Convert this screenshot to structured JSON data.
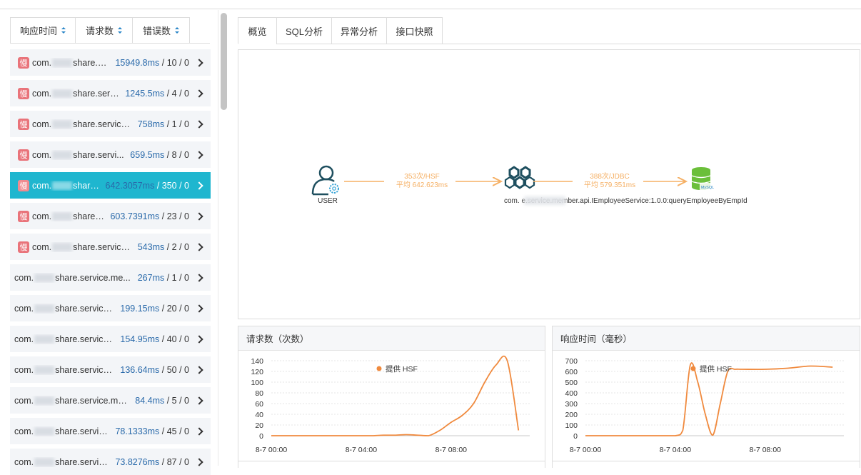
{
  "sort_tabs": [
    {
      "label": "响应时间"
    },
    {
      "label": "请求数"
    },
    {
      "label": "错误数"
    }
  ],
  "slow_label": "慢",
  "rows": [
    {
      "prefix": "com.",
      "suffix": "share.s...",
      "ms": "15949.8ms",
      "rest": " / 10 / 0",
      "slow": true
    },
    {
      "prefix": "com.",
      "suffix": "share.serv...",
      "ms": "1245.5ms",
      "rest": " / 4 / 0",
      "slow": true
    },
    {
      "prefix": "com.",
      "suffix": "share.service...",
      "ms": "758ms",
      "rest": " / 1 / 0",
      "slow": true
    },
    {
      "prefix": "com.",
      "suffix": "share.servi...",
      "ms": "659.5ms",
      "rest": " / 8 / 0",
      "slow": true
    },
    {
      "prefix": "com.",
      "suffix": "share...",
      "ms": "642.3057ms",
      "rest": " / 350 / 0",
      "slow": true,
      "active": true
    },
    {
      "prefix": "com.",
      "suffix": "share....",
      "ms": "603.7391ms",
      "rest": " / 23 / 0",
      "slow": true
    },
    {
      "prefix": "com.",
      "suffix": "share.service...",
      "ms": "543ms",
      "rest": " / 2 / 0",
      "slow": true
    },
    {
      "prefix": "com.",
      "suffix": "share.service.me...",
      "ms": "267ms",
      "rest": " / 1 / 0",
      "slow": false
    },
    {
      "prefix": "com.",
      "suffix": "share.service....",
      "ms": "199.15ms",
      "rest": " / 20 / 0",
      "slow": false
    },
    {
      "prefix": "com.",
      "suffix": "share.service....",
      "ms": "154.95ms",
      "rest": " / 40 / 0",
      "slow": false
    },
    {
      "prefix": "com.",
      "suffix": "share.service....",
      "ms": "136.64ms",
      "rest": " / 50 / 0",
      "slow": false
    },
    {
      "prefix": "com.",
      "suffix": "share.service.me...",
      "ms": "84.4ms",
      "rest": " / 5 / 0",
      "slow": false
    },
    {
      "prefix": "com.",
      "suffix": "share.servic...",
      "ms": "78.1333ms",
      "rest": " / 45 / 0",
      "slow": false
    },
    {
      "prefix": "com.",
      "suffix": "share.servic...",
      "ms": "73.8276ms",
      "rest": " / 87 / 0",
      "slow": false
    }
  ],
  "tabs": [
    {
      "label": "概览"
    },
    {
      "label": "SQL分析"
    },
    {
      "label": "异常分析"
    },
    {
      "label": "接口快照"
    }
  ],
  "topology": {
    "user_label": "USER",
    "service_label": "com.          e.service.member.api.IEmployeeService:1.0.0:queryEmployeeByEmpId",
    "db_badge": "MySQL",
    "edge1_line1": "353次/HSF",
    "edge1_line2": "平均 642.623ms",
    "edge2_line1": "388次/JDBC",
    "edge2_line2": "平均 579.351ms",
    "colors": {
      "edge": "#f5b065",
      "service": "#1e4f5f",
      "db": "#6bbf3a",
      "user": "#1e4f5f",
      "gear": "#3aa6d8"
    }
  },
  "chart_titles": {
    "requests": "请求数（次数）",
    "response": "响应时间（毫秒）"
  },
  "chart_data": [
    {
      "type": "line",
      "title": "请求数（次数）",
      "legend_position": "top-center",
      "series": [
        {
          "name": "提供 HSF",
          "color": "#f08a3e",
          "x": [
            "00:00",
            "01:00",
            "02:00",
            "03:00",
            "04:00",
            "04:30",
            "05:00",
            "05:30",
            "06:00",
            "06:30",
            "07:00",
            "07:30",
            "08:00",
            "08:30",
            "09:00",
            "09:30",
            "10:00",
            "10:30",
            "11:00"
          ],
          "values": [
            0,
            0,
            0,
            0,
            0,
            0,
            1,
            1,
            2,
            1,
            0,
            10,
            25,
            38,
            60,
            100,
            132,
            140,
            10
          ]
        }
      ],
      "x_ticks": [
        "8-7 00:00",
        "8-7 04:00",
        "8-7 08:00"
      ],
      "y_ticks": [
        0,
        20,
        40,
        60,
        80,
        100,
        120,
        140
      ],
      "ylim": [
        0,
        140
      ],
      "grid": true
    },
    {
      "type": "line",
      "title": "响应时间（毫秒）",
      "legend_position": "top-center",
      "series": [
        {
          "name": "提供 HSF",
          "color": "#f08a3e",
          "x": [
            "00:00",
            "01:00",
            "02:00",
            "03:00",
            "04:00",
            "04:20",
            "04:40",
            "05:00",
            "05:20",
            "05:40",
            "06:00",
            "06:20",
            "06:40",
            "07:00",
            "08:00",
            "09:00",
            "10:00",
            "11:00"
          ],
          "values": [
            0,
            0,
            0,
            0,
            0,
            50,
            660,
            500,
            200,
            5,
            300,
            600,
            620,
            620,
            620,
            630,
            650,
            640
          ]
        }
      ],
      "x_ticks": [
        "8-7 00:00",
        "8-7 04:00",
        "8-7 08:00"
      ],
      "y_ticks": [
        0,
        100,
        200,
        300,
        400,
        500,
        600,
        700
      ],
      "ylim": [
        0,
        700
      ],
      "grid": true
    }
  ]
}
